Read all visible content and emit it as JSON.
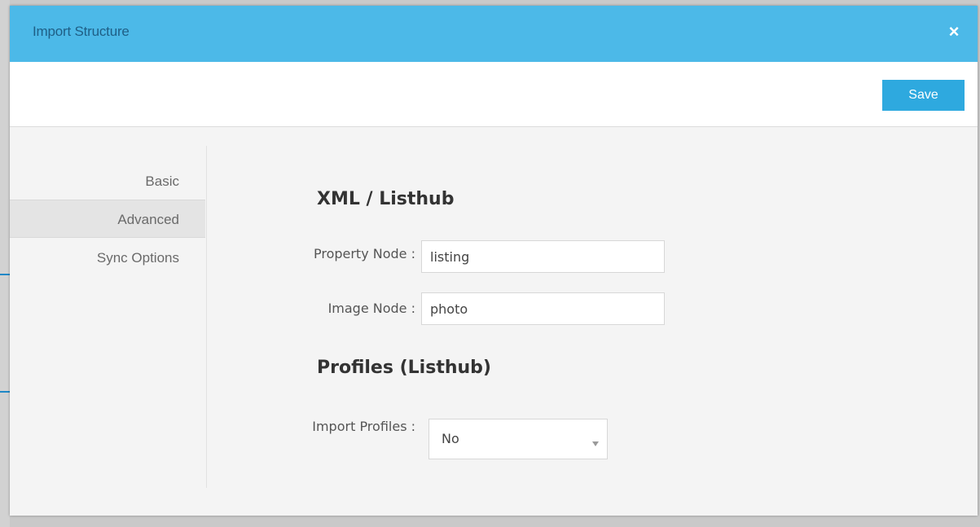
{
  "modal": {
    "title": "Import Structure",
    "close_glyph": "×",
    "save_label": "Save"
  },
  "nav": {
    "items": [
      {
        "label": "Basic",
        "active": false
      },
      {
        "label": "Advanced",
        "active": true
      },
      {
        "label": "Sync Options",
        "active": false
      }
    ]
  },
  "form": {
    "xml_section_title": "XML / Listhub",
    "property_node": {
      "label": "Property Node :",
      "value": "listing"
    },
    "image_node": {
      "label": "Image Node :",
      "value": "photo"
    },
    "profiles_section_title": "Profiles (Listhub)",
    "import_profiles": {
      "label": "Import Profiles :",
      "value": "No"
    }
  },
  "icons": {
    "close": "close-icon",
    "dropdown": "chevron-down-icon"
  },
  "colors": {
    "header_bg": "#4cb9e8",
    "title_text": "#1f5f86",
    "save_button": "#2ea9df",
    "body_bg": "#f4f4f4",
    "active_nav_bg": "#e4e4e4"
  }
}
